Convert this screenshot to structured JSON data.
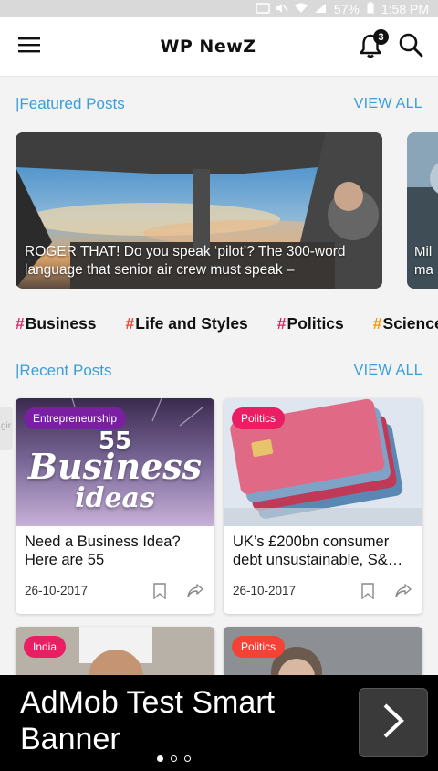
{
  "status_bar": {
    "battery": "57%",
    "time": "1:58 PM",
    "icons": [
      "cast-icon",
      "mute-icon",
      "wifi-icon",
      "signal-icon",
      "battery-icon"
    ]
  },
  "header": {
    "title": "WP NewZ",
    "notification_count": "3"
  },
  "featured": {
    "title": "|Featured Posts",
    "view_all": "VIEW ALL",
    "cards": [
      {
        "caption": "ROGER THAT! Do you speak ‘pilot’? The 300-word language that senior air crew must speak –"
      },
      {
        "caption": "Mil ma"
      }
    ]
  },
  "tags": [
    {
      "hash": "#",
      "label": "Business",
      "hash_color": "#e91e63"
    },
    {
      "hash": "#",
      "label": "Life and Styles",
      "hash_color": "#f44336"
    },
    {
      "hash": "#",
      "label": "Politics",
      "hash_color": "#e91e63"
    },
    {
      "hash": "#",
      "label": "Science",
      "hash_color": "#ff9800"
    }
  ],
  "recent": {
    "title": "|Recent Posts",
    "view_all": "VIEW ALL",
    "posts": [
      {
        "category": "Entrepreneurship",
        "category_color": "#7b1fa2",
        "title": "Need a Business Idea? Here are 55",
        "date": "26-10-2017",
        "image_text_top": "55",
        "image_text_mid": "Business",
        "image_text_bot": "ideas"
      },
      {
        "category": "Politics",
        "category_color": "#e91e63",
        "title": "UK’s £200bn consumer debt unsustainable, S&…",
        "date": "26-10-2017"
      },
      {
        "category": "India",
        "category_color": "#e91e63"
      },
      {
        "category": "Politics",
        "category_color": "#f44336"
      }
    ]
  },
  "ad": {
    "text": "AdMob Test Smart Banner"
  },
  "left_peek_text": "gir"
}
